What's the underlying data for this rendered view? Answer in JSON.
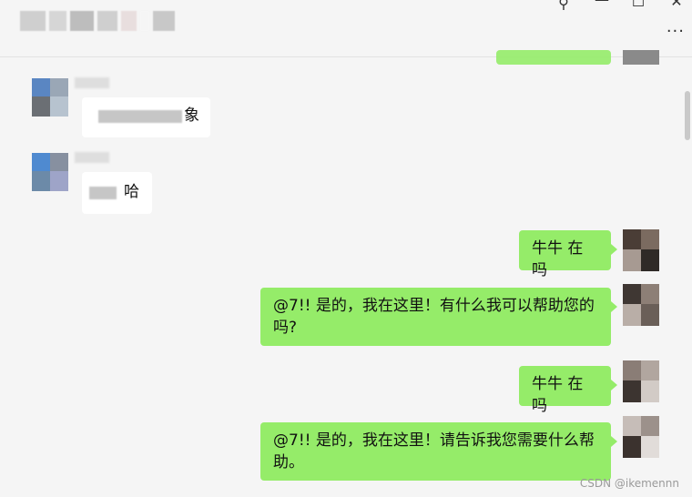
{
  "window": {
    "pin_icon": "pin-icon",
    "minimize_icon": "minimize-icon",
    "maximize_icon": "maximize-icon",
    "close_icon": "close-icon",
    "more_label": "···"
  },
  "messages": [
    {
      "side": "left",
      "sender_blurred": true,
      "text_blurred": true,
      "visible_tail": "象"
    },
    {
      "side": "left",
      "sender_blurred": true,
      "text_blurred": true,
      "visible_tail": "哈"
    },
    {
      "side": "right",
      "text": "牛牛 在吗"
    },
    {
      "side": "right",
      "text": "@7!! 是的，我在这里！有什么我可以帮助您的吗?"
    },
    {
      "side": "right",
      "text": "牛牛 在吗"
    },
    {
      "side": "right",
      "text": "@7!! 是的，我在这里！请告诉我您需要什么帮助。"
    }
  ],
  "watermark": "CSDN @ikemennn",
  "colors": {
    "bubble_self": "#95ec69",
    "bubble_other": "#ffffff",
    "background": "#f5f5f5"
  }
}
